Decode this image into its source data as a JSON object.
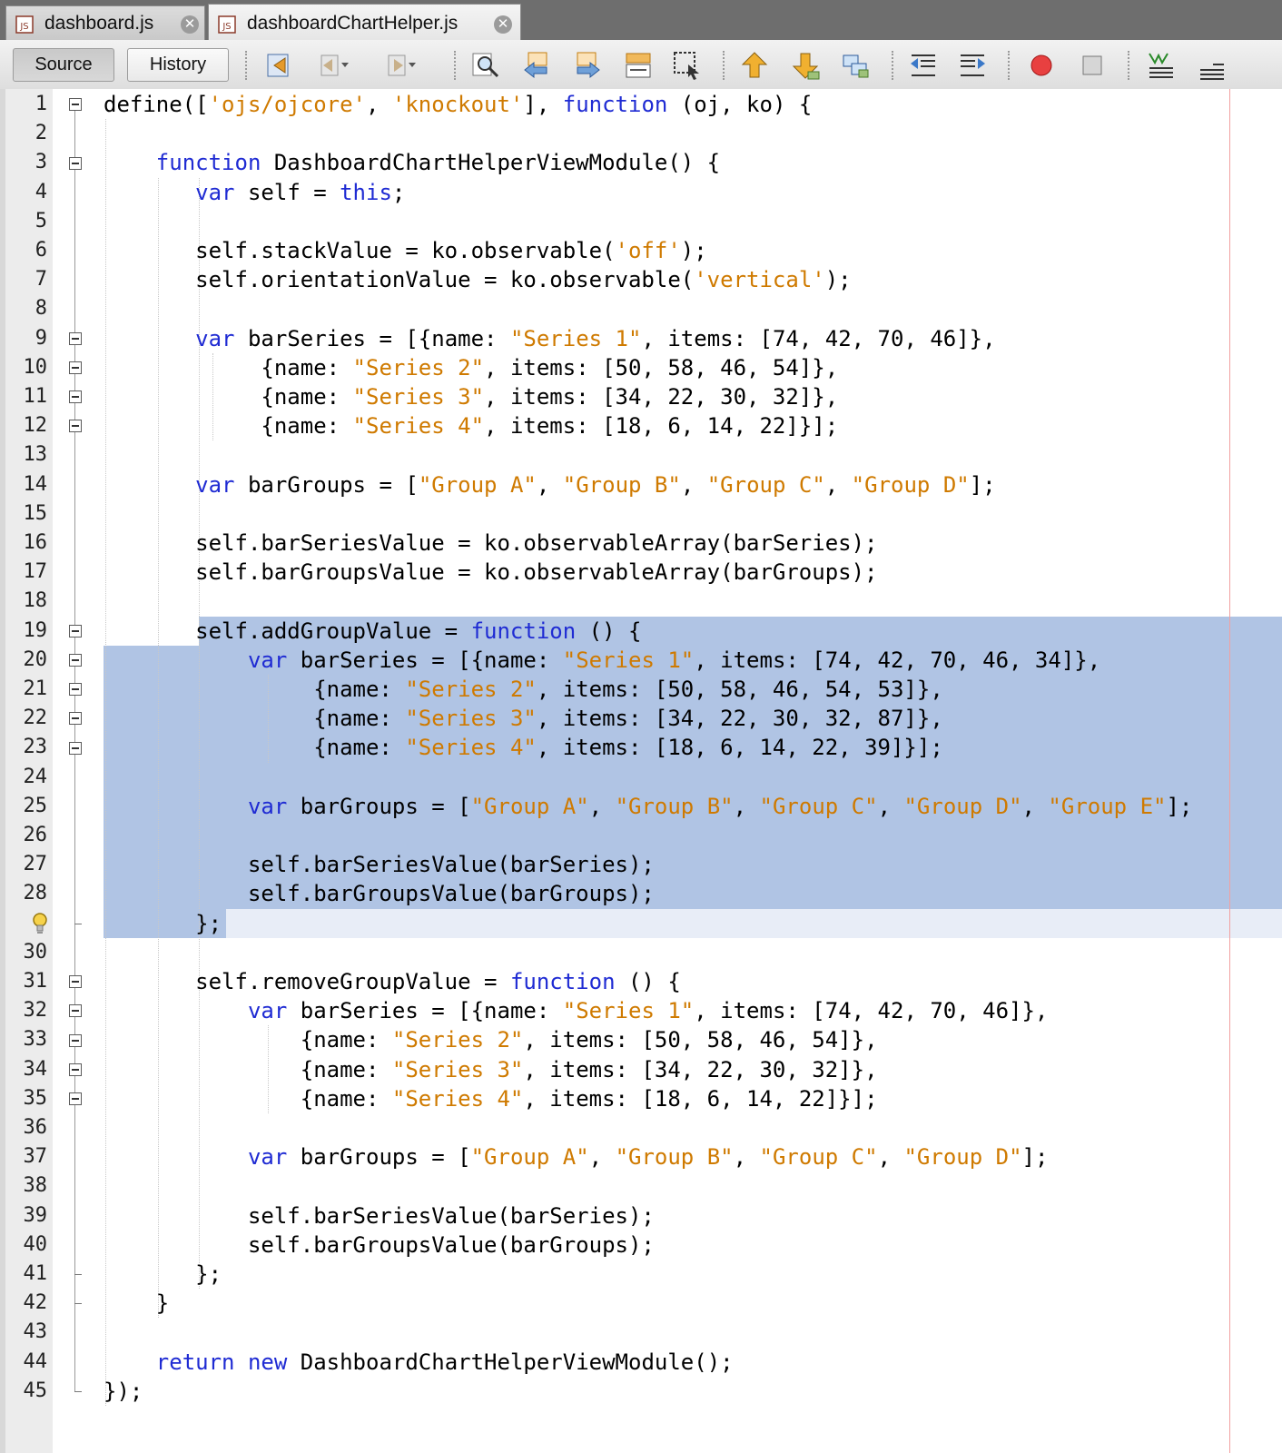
{
  "tabs": [
    {
      "label": "dashboard.js",
      "active": false
    },
    {
      "label": "dashboardChartHelper.js",
      "active": true
    }
  ],
  "toolbar": {
    "source_label": "Source",
    "history_label": "History",
    "icons": [
      "last-edit-icon",
      "back-icon",
      "forward-icon",
      "find-icon",
      "find-previous-icon",
      "find-next-icon",
      "toggle-highlight-icon",
      "find-selection-icon",
      "previous-bookmark-icon",
      "next-bookmark-icon",
      "toggle-bookmark-icon",
      "shift-left-icon",
      "shift-right-icon",
      "start-macro-icon",
      "stop-macro-icon",
      "comment-icon",
      "uncomment-icon"
    ]
  },
  "colors": {
    "keyword": "#1f2bd3",
    "string": "#cf7a00",
    "selection": "#b0c4e4",
    "current_line": "#e8edf7"
  },
  "editor": {
    "lines": [
      [
        [
          "t",
          "define(["
        ],
        [
          "s",
          "'ojs/ojcore'"
        ],
        [
          "t",
          ", "
        ],
        [
          "s",
          "'knockout'"
        ],
        [
          "t",
          "], "
        ],
        [
          "k",
          "function"
        ],
        [
          "t",
          " (oj, ko) {"
        ]
      ],
      [],
      [
        [
          "t",
          "    "
        ],
        [
          "k",
          "function"
        ],
        [
          "t",
          " DashboardChartHelperViewModule() {"
        ]
      ],
      [
        [
          "t",
          "       "
        ],
        [
          "k",
          "var"
        ],
        [
          "t",
          " self = "
        ],
        [
          "k",
          "this"
        ],
        [
          "t",
          ";"
        ]
      ],
      [],
      [
        [
          "t",
          "       self.stackValue = ko.observable("
        ],
        [
          "s",
          "'off'"
        ],
        [
          "t",
          ");"
        ]
      ],
      [
        [
          "t",
          "       self.orientationValue = ko.observable("
        ],
        [
          "s",
          "'vertical'"
        ],
        [
          "t",
          ");"
        ]
      ],
      [],
      [
        [
          "t",
          "       "
        ],
        [
          "k",
          "var"
        ],
        [
          "t",
          " barSeries = [{name: "
        ],
        [
          "s",
          "\"Series 1\""
        ],
        [
          "t",
          ", items: [74, 42, 70, 46]},"
        ]
      ],
      [
        [
          "t",
          "            {name: "
        ],
        [
          "s",
          "\"Series 2\""
        ],
        [
          "t",
          ", items: [50, 58, 46, 54]},"
        ]
      ],
      [
        [
          "t",
          "            {name: "
        ],
        [
          "s",
          "\"Series 3\""
        ],
        [
          "t",
          ", items: [34, 22, 30, 32]},"
        ]
      ],
      [
        [
          "t",
          "            {name: "
        ],
        [
          "s",
          "\"Series 4\""
        ],
        [
          "t",
          ", items: [18, 6, 14, 22]}];"
        ]
      ],
      [],
      [
        [
          "t",
          "       "
        ],
        [
          "k",
          "var"
        ],
        [
          "t",
          " barGroups = ["
        ],
        [
          "s",
          "\"Group A\""
        ],
        [
          "t",
          ", "
        ],
        [
          "s",
          "\"Group B\""
        ],
        [
          "t",
          ", "
        ],
        [
          "s",
          "\"Group C\""
        ],
        [
          "t",
          ", "
        ],
        [
          "s",
          "\"Group D\""
        ],
        [
          "t",
          "];"
        ]
      ],
      [],
      [
        [
          "t",
          "       self.barSeriesValue = ko.observableArray(barSeries);"
        ]
      ],
      [
        [
          "t",
          "       self.barGroupsValue = ko.observableArray(barGroups);"
        ]
      ],
      [],
      [
        [
          "t",
          "       self.addGroupValue = "
        ],
        [
          "k",
          "function"
        ],
        [
          "t",
          " () {"
        ]
      ],
      [
        [
          "t",
          "           "
        ],
        [
          "k",
          "var"
        ],
        [
          "t",
          " barSeries = [{name: "
        ],
        [
          "s",
          "\"Series 1\""
        ],
        [
          "t",
          ", items: [74, 42, 70, 46, 34]},"
        ]
      ],
      [
        [
          "t",
          "                {name: "
        ],
        [
          "s",
          "\"Series 2\""
        ],
        [
          "t",
          ", items: [50, 58, 46, 54, 53]},"
        ]
      ],
      [
        [
          "t",
          "                {name: "
        ],
        [
          "s",
          "\"Series 3\""
        ],
        [
          "t",
          ", items: [34, 22, 30, 32, 87]},"
        ]
      ],
      [
        [
          "t",
          "                {name: "
        ],
        [
          "s",
          "\"Series 4\""
        ],
        [
          "t",
          ", items: [18, 6, 14, 22, 39]}];"
        ]
      ],
      [],
      [
        [
          "t",
          "           "
        ],
        [
          "k",
          "var"
        ],
        [
          "t",
          " barGroups = ["
        ],
        [
          "s",
          "\"Group A\""
        ],
        [
          "t",
          ", "
        ],
        [
          "s",
          "\"Group B\""
        ],
        [
          "t",
          ", "
        ],
        [
          "s",
          "\"Group C\""
        ],
        [
          "t",
          ", "
        ],
        [
          "s",
          "\"Group D\""
        ],
        [
          "t",
          ", "
        ],
        [
          "s",
          "\"Group E\""
        ],
        [
          "t",
          "];"
        ]
      ],
      [],
      [
        [
          "t",
          "           self.barSeriesValue(barSeries);"
        ]
      ],
      [
        [
          "t",
          "           self.barGroupsValue(barGroups);"
        ]
      ],
      [
        [
          "t",
          "       };"
        ]
      ],
      [],
      [
        [
          "t",
          "       self.removeGroupValue = "
        ],
        [
          "k",
          "function"
        ],
        [
          "t",
          " () {"
        ]
      ],
      [
        [
          "t",
          "           "
        ],
        [
          "k",
          "var"
        ],
        [
          "t",
          " barSeries = [{name: "
        ],
        [
          "s",
          "\"Series 1\""
        ],
        [
          "t",
          ", items: [74, 42, 70, 46]},"
        ]
      ],
      [
        [
          "t",
          "               {name: "
        ],
        [
          "s",
          "\"Series 2\""
        ],
        [
          "t",
          ", items: [50, 58, 46, 54]},"
        ]
      ],
      [
        [
          "t",
          "               {name: "
        ],
        [
          "s",
          "\"Series 3\""
        ],
        [
          "t",
          ", items: [34, 22, 30, 32]},"
        ]
      ],
      [
        [
          "t",
          "               {name: "
        ],
        [
          "s",
          "\"Series 4\""
        ],
        [
          "t",
          ", items: [18, 6, 14, 22]}];"
        ]
      ],
      [],
      [
        [
          "t",
          "           "
        ],
        [
          "k",
          "var"
        ],
        [
          "t",
          " barGroups = ["
        ],
        [
          "s",
          "\"Group A\""
        ],
        [
          "t",
          ", "
        ],
        [
          "s",
          "\"Group B\""
        ],
        [
          "t",
          ", "
        ],
        [
          "s",
          "\"Group C\""
        ],
        [
          "t",
          ", "
        ],
        [
          "s",
          "\"Group D\""
        ],
        [
          "t",
          "];"
        ]
      ],
      [],
      [
        [
          "t",
          "           self.barSeriesValue(barSeries);"
        ]
      ],
      [
        [
          "t",
          "           self.barGroupsValue(barGroups);"
        ]
      ],
      [
        [
          "t",
          "       };"
        ]
      ],
      [
        [
          "t",
          "    }"
        ]
      ],
      [],
      [
        [
          "t",
          "    "
        ],
        [
          "k",
          "return"
        ],
        [
          "t",
          " "
        ],
        [
          "k",
          "new"
        ],
        [
          "t",
          " DashboardChartHelperViewModule();"
        ]
      ],
      [
        [
          "t",
          "});"
        ]
      ]
    ],
    "line_numbers": [
      "1",
      "2",
      "3",
      "4",
      "5",
      "6",
      "7",
      "8",
      "9",
      "10",
      "11",
      "12",
      "13",
      "14",
      "15",
      "16",
      "17",
      "18",
      "19",
      "20",
      "21",
      "22",
      "23",
      "24",
      "25",
      "26",
      "27",
      "28",
      "",
      "30",
      "31",
      "32",
      "33",
      "34",
      "35",
      "36",
      "37",
      "38",
      "39",
      "40",
      "41",
      "42",
      "43",
      "44",
      "45"
    ],
    "hint_line": 29,
    "fold_lines": [
      1,
      3,
      9,
      10,
      11,
      12,
      19,
      20,
      21,
      22,
      23,
      31,
      32,
      33,
      34,
      35
    ],
    "fold_end_lines": [
      29,
      41,
      42,
      45
    ],
    "selected_lines": [
      19,
      29
    ]
  }
}
